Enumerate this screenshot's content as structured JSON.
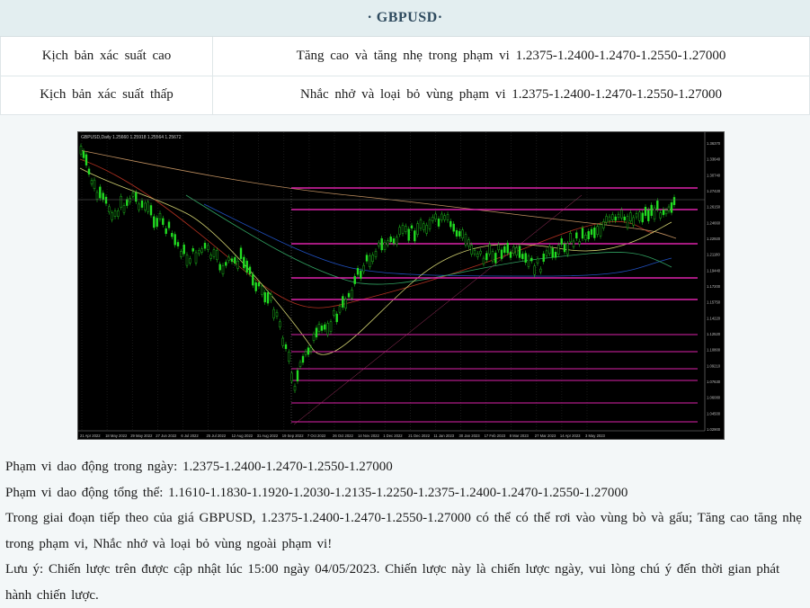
{
  "header": {
    "title": "· GBPUSD·"
  },
  "scenarios": [
    {
      "label": "Kịch bản xác suất cao",
      "text": "Tăng cao và tăng nhẹ trong phạm vi 1.2375-1.2400-1.2470-1.2550-1.27000"
    },
    {
      "label": "Kịch bản xác suất thấp",
      "text": "Nhắc nhở và loại bỏ vùng phạm vi 1.2375-1.2400-1.2470-1.2550-1.27000"
    }
  ],
  "chart": {
    "legend": "GBPUSD,Daily  1.25660 1.25918 1.25564 1.25672",
    "x_labels": [
      "21 Apr 2022",
      "18 May 2022",
      "29 May 2022",
      "27 Jun 2022",
      "6 Jul 2022",
      "25 Jul 2022",
      "12 Aug 2022",
      "31 Aug 2022",
      "19 Sep 2022",
      "7 Oct 2022",
      "26 Oct 2022",
      "14 Nov 2022",
      "1 Dec 2022",
      "21 Dec 2022",
      "11 Jan 2023",
      "30 Jan 2023",
      "17 Feb 2023",
      "8 Mar 2023",
      "27 Mar 2023",
      "14 Apr 2023",
      "3 May 2023"
    ],
    "price_labels": [
      "1.36370",
      "1.33640",
      "1.30740",
      "1.27420",
      "1.26150",
      "1.24660",
      "1.22920",
      "1.21180",
      "1.19440",
      "1.17200",
      "1.15750",
      "1.14220",
      "1.12520",
      "1.10800",
      "1.09210",
      "1.07630",
      "1.06080",
      "1.04500",
      "1.02900"
    ],
    "colors": {
      "background": "#000000",
      "candle": "#22dd22",
      "level": "#dd22aa",
      "grid": "#2a2a2a"
    }
  },
  "text": {
    "intraday": "Phạm vi dao động trong ngày: 1.2375-1.2400-1.2470-1.2550-1.27000",
    "overall": "Phạm vi dao động tổng thể: 1.1610-1.1830-1.1920-1.2030-1.2135-1.2250-1.2375-1.2400-1.2470-1.2550-1.27000",
    "outlook": "Trong giai đoạn tiếp theo của giá GBPUSD, 1.2375-1.2400-1.2470-1.2550-1.27000 có thể có thể rơi vào vùng bò và gấu; Tăng cao tăng nhẹ trong phạm vi, Nhắc nhở và loại bỏ vùng ngoài phạm vi!",
    "note": "Lưu ý: Chiến lược trên được cập nhật lúc 15:00 ngày 04/05/2023. Chiến lược này là chiến lược ngày, vui lòng chú ý đến thời gian phát hành chiến lược."
  }
}
